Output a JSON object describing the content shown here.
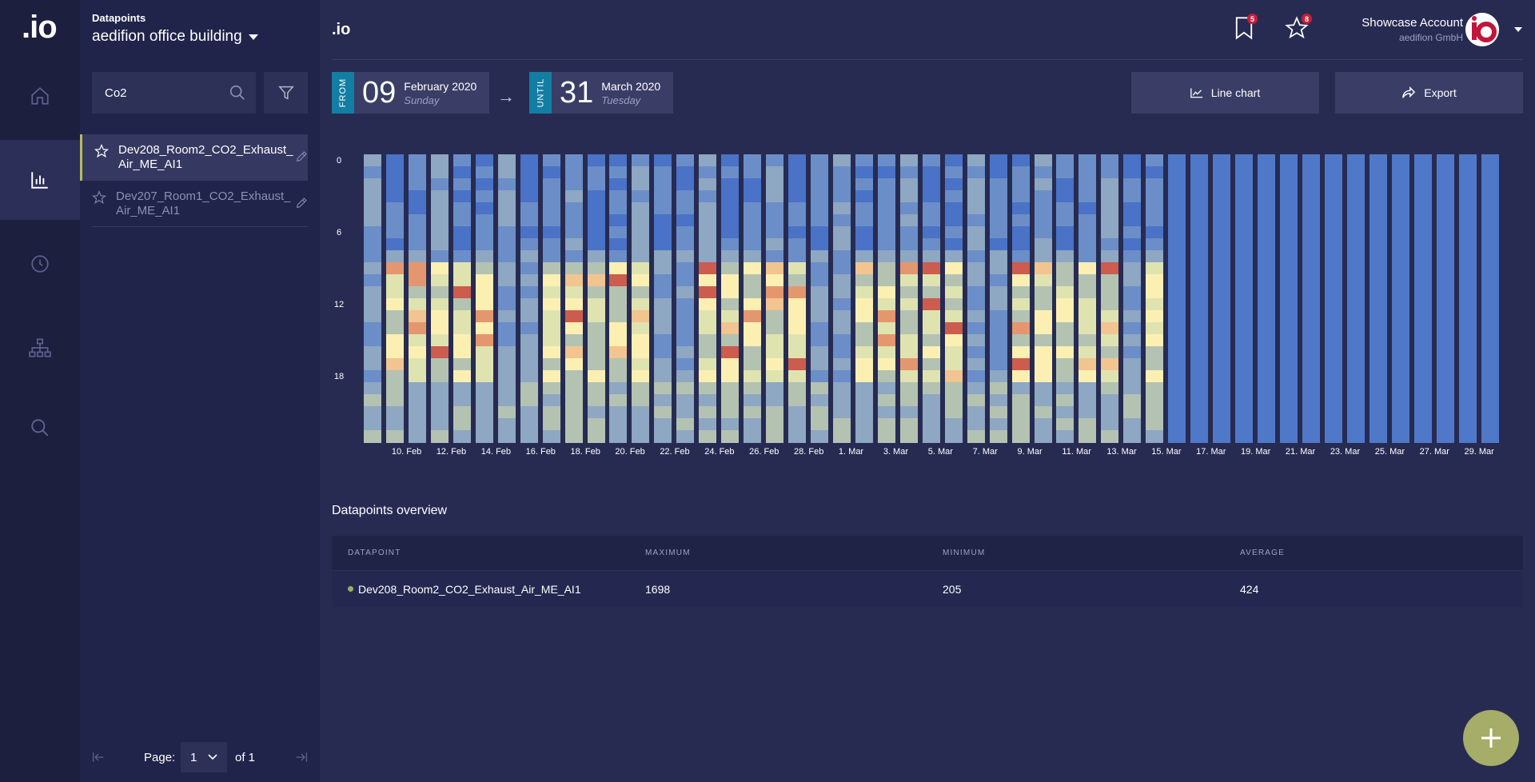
{
  "rail": {
    "logo": ".io",
    "items": [
      {
        "name": "home-icon",
        "active": false
      },
      {
        "name": "bar-chart-icon",
        "active": true
      },
      {
        "name": "clock-icon",
        "active": false
      },
      {
        "name": "hierarchy-icon",
        "active": false
      },
      {
        "name": "search-icon",
        "active": false
      }
    ]
  },
  "sidebar": {
    "section_label": "Datapoints",
    "building": "aedifion office building",
    "search": {
      "value": "Co2",
      "placeholder": ""
    },
    "datapoints": [
      {
        "name": "Dev208_Room2_CO2_Exhaust_Air_ME_AI1",
        "active": true
      },
      {
        "name": "Dev207_Room1_CO2_Exhaust_Air_ME_AI1",
        "active": false
      }
    ],
    "pager": {
      "label": "Page:",
      "current": "1",
      "of": "of 1"
    }
  },
  "header": {
    "brand": ".io",
    "bookmarks_count": "5",
    "favorites_count": "8",
    "account_name": "Showcase Account",
    "account_org": "aedifion GmbH"
  },
  "range": {
    "from": {
      "tag": "FROM",
      "day": "09",
      "month_year": "February 2020",
      "weekday": "Sunday"
    },
    "until": {
      "tag": "UNTIL",
      "day": "31",
      "month_year": "March 2020",
      "weekday": "Tuesday"
    },
    "arrow": "→"
  },
  "actions": {
    "line_chart": "Line chart",
    "export": "Export"
  },
  "chart_data": {
    "type": "heatmap",
    "y_ticks": [
      "0",
      "6",
      "12",
      "18"
    ],
    "y_range_hours": [
      0,
      24
    ],
    "x_ticks": [
      "10. Feb",
      "12. Feb",
      "14. Feb",
      "16. Feb",
      "18. Feb",
      "20. Feb",
      "22. Feb",
      "24. Feb",
      "26. Feb",
      "28. Feb",
      "1. Mar",
      "3. Mar",
      "5. Mar",
      "7. Mar",
      "9. Mar",
      "11. Mar",
      "13. Mar",
      "15. Mar",
      "17. Mar",
      "19. Mar",
      "21. Mar",
      "23. Mar",
      "25. Mar",
      "27. Mar",
      "29. Mar"
    ],
    "x_range": [
      "2020-02-09",
      "2020-03-31"
    ],
    "days_with_data": 36,
    "colorscale": [
      "#4a72c6",
      "#6b8ec8",
      "#8ea7c2",
      "#b4c2b2",
      "#dfe3b0",
      "#fbf0b2",
      "#f2c48f",
      "#e4976e",
      "#cc5c4e"
    ],
    "no_data_color": "#5078c9"
  },
  "overview": {
    "title": "Datapoints overview",
    "headers": [
      "DATAPOINT",
      "MAXIMUM",
      "MINIMUM",
      "AVERAGE"
    ],
    "rows": [
      {
        "datapoint": "Dev208_Room2_CO2_Exhaust_Air_ME_AI1",
        "max": "1698",
        "min": "205",
        "avg": "424"
      }
    ]
  }
}
